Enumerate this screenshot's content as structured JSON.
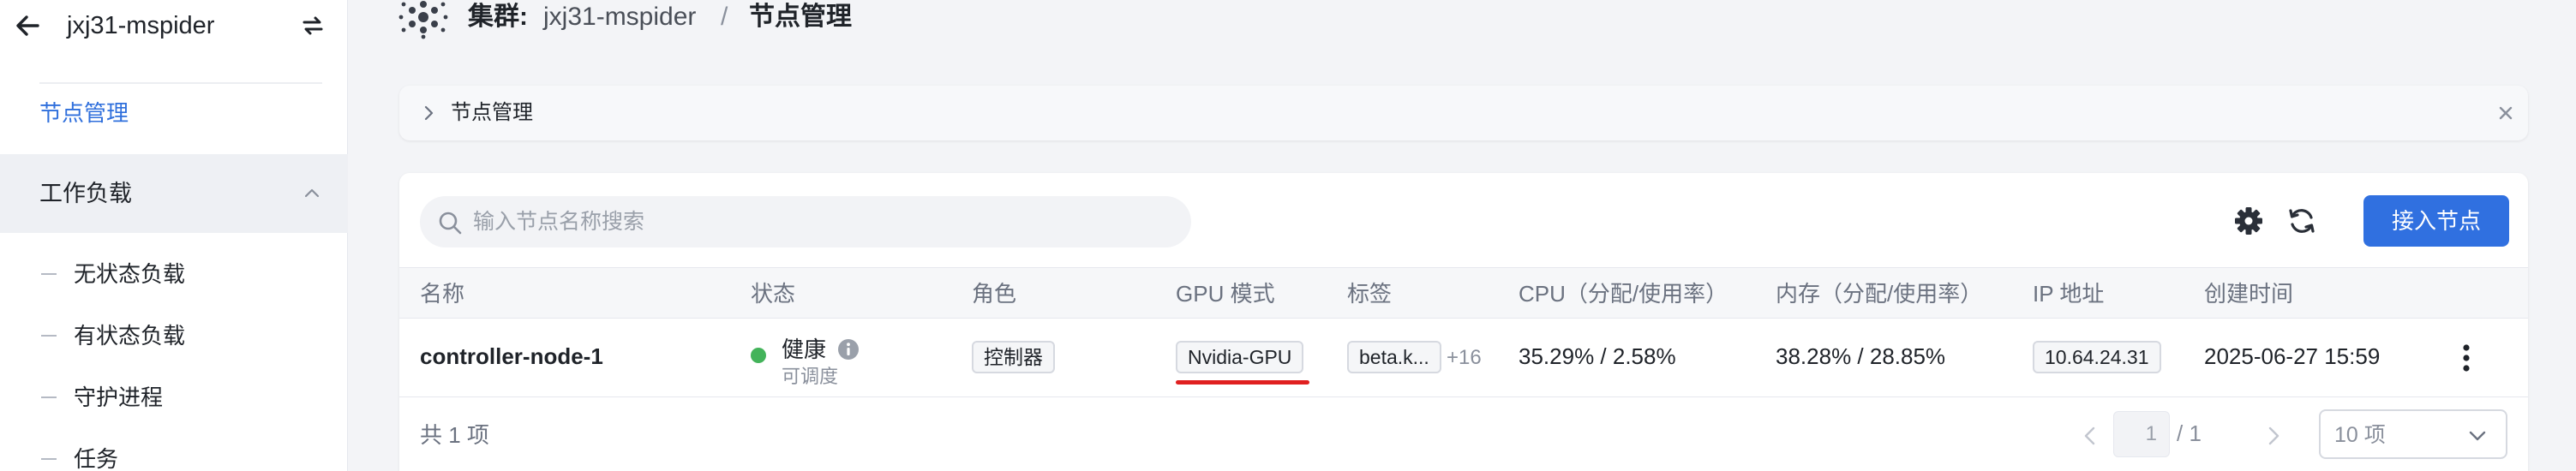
{
  "sidebar": {
    "title": "jxj31-mspider",
    "active_item": "节点管理",
    "group_label": "工作负载",
    "sub_items": [
      "无状态负载",
      "有状态负载",
      "守护进程",
      "任务"
    ]
  },
  "topbar": {
    "cluster_label": "集群:",
    "cluster_name": "jxj31-mspider",
    "separator": "/",
    "current": "节点管理"
  },
  "strip": {
    "title": "节点管理"
  },
  "toolbar": {
    "search_placeholder": "输入节点名称搜索",
    "primary_button": "接入节点"
  },
  "table": {
    "columns": [
      "名称",
      "状态",
      "角色",
      "GPU 模式",
      "标签",
      "CPU（分配/使用率）",
      "内存（分配/使用率）",
      "IP 地址",
      "创建时间"
    ],
    "rows": [
      {
        "name": "controller-node-1",
        "status": "健康",
        "status_sub": "可调度",
        "role": "控制器",
        "gpu_mode": "Nvidia-GPU",
        "label": "beta.k...",
        "label_more": "+16",
        "cpu": "35.29% / 2.58%",
        "memory": "38.28% / 28.85%",
        "ip": "10.64.24.31",
        "created": "2025-06-27 15:59"
      }
    ]
  },
  "pagination": {
    "total_text": "共 1 项",
    "current_page": "1",
    "page_total": "/ 1",
    "page_size": "10 项"
  },
  "colors": {
    "accent": "#3070e0",
    "status_ok": "#43b35a",
    "highlight_underline": "#e02020"
  },
  "icons": [
    "arrow-left-icon",
    "switch-icon",
    "chevron-up-icon",
    "cluster-logo-icon",
    "chevron-right-icon",
    "close-icon",
    "search-icon",
    "gear-icon",
    "refresh-icon",
    "info-icon",
    "more-vertical-icon",
    "chevron-left-icon",
    "chevron-down-icon"
  ]
}
